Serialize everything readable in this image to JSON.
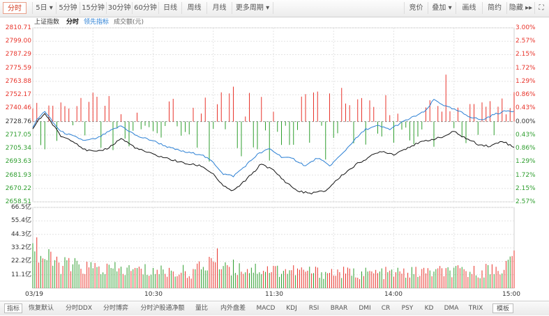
{
  "toolbar": {
    "left": [
      {
        "label": "分时",
        "active": true
      },
      {
        "label": "5日 ▾",
        "active": false
      },
      {
        "label": "5分钟",
        "active": false
      },
      {
        "label": "15分钟",
        "active": false
      },
      {
        "label": "30分钟",
        "active": false
      },
      {
        "label": "60分钟",
        "active": false
      },
      {
        "label": "日线",
        "active": false
      },
      {
        "label": "周线",
        "active": false
      },
      {
        "label": "月线",
        "active": false
      },
      {
        "label": "更多周期 ▾",
        "active": false
      }
    ],
    "right": [
      {
        "label": "竞价"
      },
      {
        "label": "叠加 ▾"
      },
      {
        "label": "画线"
      },
      {
        "label": "简约"
      },
      {
        "label": "隐藏 ▸▸"
      },
      {
        "label": "⛶"
      }
    ]
  },
  "info": {
    "index_name": "上证指数",
    "mode": "分时",
    "lead": "领先指标",
    "volume": "成交额(元)"
  },
  "price_axis": {
    "left": [
      "2810.71",
      "2799.00",
      "2787.29",
      "2775.59",
      "2763.88",
      "2752.17",
      "2740.46",
      "2728.76",
      "2717.05",
      "2705.34",
      "2693.63",
      "2681.93",
      "2670.22",
      "2658.51"
    ],
    "right": [
      "3.00%",
      "2.57%",
      "2.15%",
      "1.72%",
      "1.29%",
      "0.86%",
      "0.43%",
      "0.00%",
      "0.43%",
      "0.86%",
      "1.29%",
      "1.72%",
      "2.15%",
      "2.57%"
    ]
  },
  "volume_axis": [
    "66.5亿",
    "55.4亿",
    "44.3亿",
    "33.2亿",
    "22.2亿",
    "11.1亿"
  ],
  "x_axis": [
    "03/19",
    "10:30",
    "11:30",
    "14:00",
    "15:00"
  ],
  "colors": {
    "up": "#e8332a",
    "down": "#2e9e2e",
    "price_line": "#111111",
    "lead_line": "#2a7fd4",
    "grid": "#e4e4e4",
    "ref": "#999999"
  },
  "chart_data": {
    "type": "line",
    "ylim": [
      2658.51,
      2810.71
    ],
    "prev_close": 2728.76,
    "price_knots": [
      [
        0,
        2722
      ],
      [
        2,
        2728
      ],
      [
        6,
        2736
      ],
      [
        10,
        2726
      ],
      [
        14,
        2716
      ],
      [
        20,
        2712
      ],
      [
        26,
        2704
      ],
      [
        32,
        2702
      ],
      [
        38,
        2706
      ],
      [
        44,
        2714
      ],
      [
        52,
        2705
      ],
      [
        60,
        2700
      ],
      [
        68,
        2696
      ],
      [
        76,
        2692
      ],
      [
        84,
        2690
      ],
      [
        90,
        2683
      ],
      [
        95,
        2672
      ],
      [
        100,
        2668
      ],
      [
        104,
        2674
      ],
      [
        110,
        2684
      ],
      [
        114,
        2692
      ],
      [
        120,
        2686
      ],
      [
        126,
        2676
      ],
      [
        132,
        2668
      ],
      [
        138,
        2666
      ],
      [
        146,
        2668
      ],
      [
        150,
        2675
      ],
      [
        155,
        2683
      ],
      [
        162,
        2692
      ],
      [
        168,
        2698
      ],
      [
        174,
        2703
      ],
      [
        180,
        2700
      ],
      [
        188,
        2707
      ],
      [
        196,
        2712
      ],
      [
        204,
        2715
      ],
      [
        210,
        2720
      ],
      [
        216,
        2714
      ],
      [
        222,
        2709
      ],
      [
        228,
        2707
      ],
      [
        234,
        2712
      ],
      [
        240,
        2706
      ]
    ],
    "lead_knots": [
      [
        0,
        2724
      ],
      [
        2,
        2730
      ],
      [
        6,
        2738
      ],
      [
        10,
        2728
      ],
      [
        14,
        2720
      ],
      [
        20,
        2716
      ],
      [
        26,
        2712
      ],
      [
        32,
        2714
      ],
      [
        38,
        2720
      ],
      [
        44,
        2725
      ],
      [
        52,
        2716
      ],
      [
        60,
        2712
      ],
      [
        68,
        2706
      ],
      [
        76,
        2702
      ],
      [
        84,
        2700
      ],
      [
        90,
        2693
      ],
      [
        95,
        2683
      ],
      [
        100,
        2681
      ],
      [
        106,
        2690
      ],
      [
        112,
        2700
      ],
      [
        118,
        2705
      ],
      [
        124,
        2698
      ],
      [
        130,
        2696
      ],
      [
        136,
        2690
      ],
      [
        142,
        2697
      ],
      [
        148,
        2690
      ],
      [
        154,
        2700
      ],
      [
        160,
        2712
      ],
      [
        166,
        2722
      ],
      [
        172,
        2725
      ],
      [
        178,
        2722
      ],
      [
        184,
        2728
      ],
      [
        190,
        2733
      ],
      [
        196,
        2738
      ],
      [
        200,
        2748
      ],
      [
        206,
        2742
      ],
      [
        212,
        2738
      ],
      [
        218,
        2733
      ],
      [
        224,
        2730
      ],
      [
        230,
        2735
      ],
      [
        236,
        2738
      ],
      [
        240,
        2738
      ]
    ],
    "volume_ylim": [
      0,
      66.5
    ],
    "volume_knots": [
      [
        0,
        48
      ],
      [
        3,
        30
      ],
      [
        8,
        24
      ],
      [
        15,
        20
      ],
      [
        25,
        18
      ],
      [
        40,
        16
      ],
      [
        60,
        15
      ],
      [
        80,
        14
      ],
      [
        86,
        20
      ],
      [
        90,
        26
      ],
      [
        100,
        18
      ],
      [
        120,
        16
      ],
      [
        140,
        14
      ],
      [
        160,
        13
      ],
      [
        180,
        13
      ],
      [
        200,
        14
      ],
      [
        220,
        14
      ],
      [
        235,
        18
      ],
      [
        239,
        24
      ],
      [
        240,
        36
      ]
    ]
  },
  "bottombar": [
    {
      "label": "指标",
      "active": true
    },
    {
      "label": "恢复默认",
      "active": false
    },
    {
      "label": "分时DDX",
      "active": false
    },
    {
      "label": "分时博弈",
      "active": false
    },
    {
      "label": "分时沪股通净额",
      "active": false
    },
    {
      "label": "量比",
      "active": false
    },
    {
      "label": "内外盘差",
      "active": false
    },
    {
      "label": "MACD",
      "active": false
    },
    {
      "label": "KDJ",
      "active": false
    },
    {
      "label": "RSI",
      "active": false
    },
    {
      "label": "BRAR",
      "active": false
    },
    {
      "label": "DMI",
      "active": false
    },
    {
      "label": "CR",
      "active": false
    },
    {
      "label": "PSY",
      "active": false
    },
    {
      "label": "KD",
      "active": false
    },
    {
      "label": "DMA",
      "active": false
    },
    {
      "label": "TRIX",
      "active": false
    },
    {
      "label": "模板",
      "active": true
    }
  ]
}
